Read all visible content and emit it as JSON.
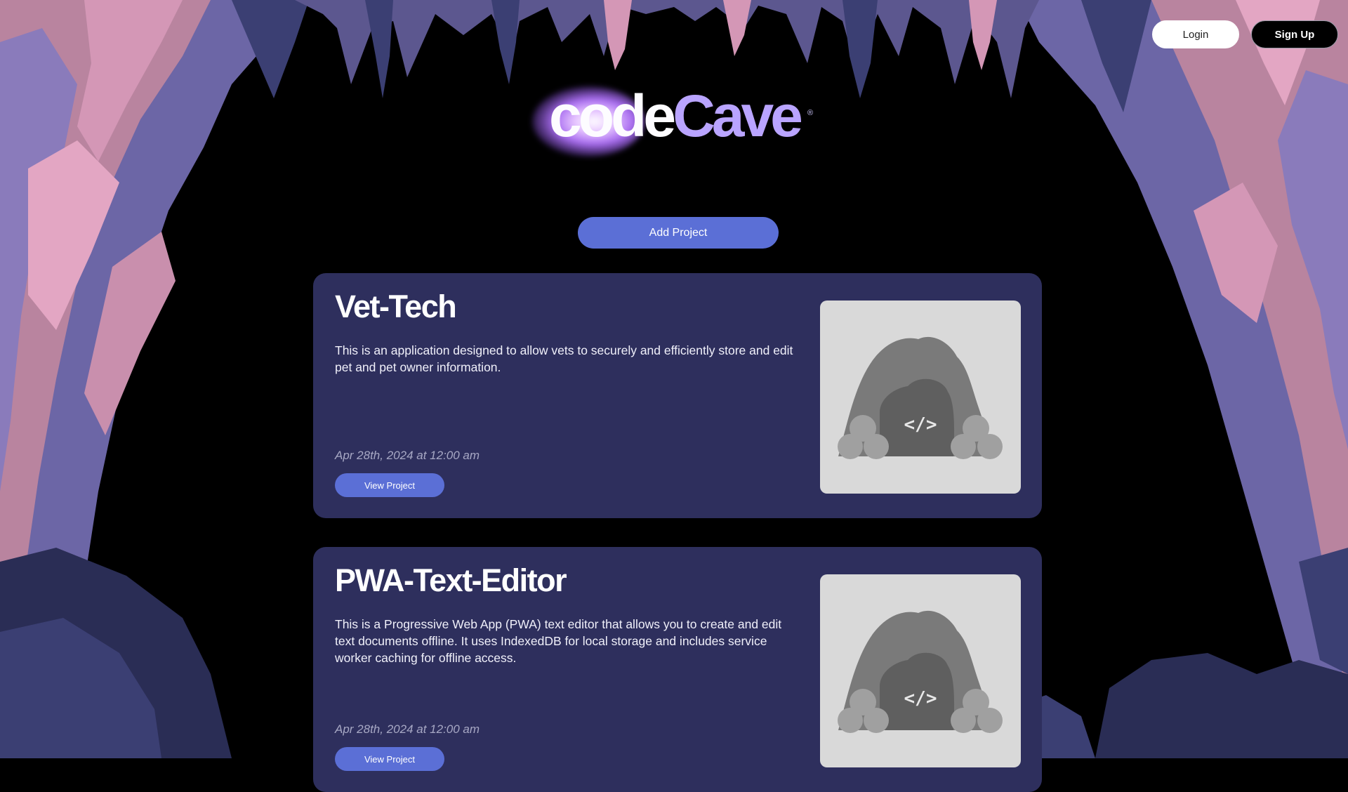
{
  "header": {
    "login_label": "Login",
    "signup_label": "Sign Up"
  },
  "logo": {
    "part1": "code",
    "part2": "Cave",
    "mark": "®"
  },
  "actions": {
    "add_project_label": "Add Project"
  },
  "projects": [
    {
      "title": "Vet-Tech",
      "description": "This is an application designed to allow vets to securely and efficiently store and edit pet and pet owner information.",
      "date": "Apr 28th, 2024 at 12:00 am",
      "button_label": "View Project",
      "thumbnail_icon": "cave-code-placeholder-icon"
    },
    {
      "title": "PWA-Text-Editor",
      "description": "This is a Progressive Web App (PWA) text editor that allows you to create and edit text documents offline. It uses IndexedDB for local storage and includes service worker caching for offline access.",
      "date": "Apr 28th, 2024 at 12:00 am",
      "button_label": "View Project",
      "thumbnail_icon": "cave-code-placeholder-icon"
    }
  ],
  "colors": {
    "page_bg": "#000000",
    "card_bg": "#2e2f5d",
    "accent_button": "#5b6fd6",
    "cave_pink": "#c48bb0",
    "cave_purple": "#6c66a6",
    "cave_navy": "#2a2d55",
    "logo_cave": "#b9a4ff"
  }
}
